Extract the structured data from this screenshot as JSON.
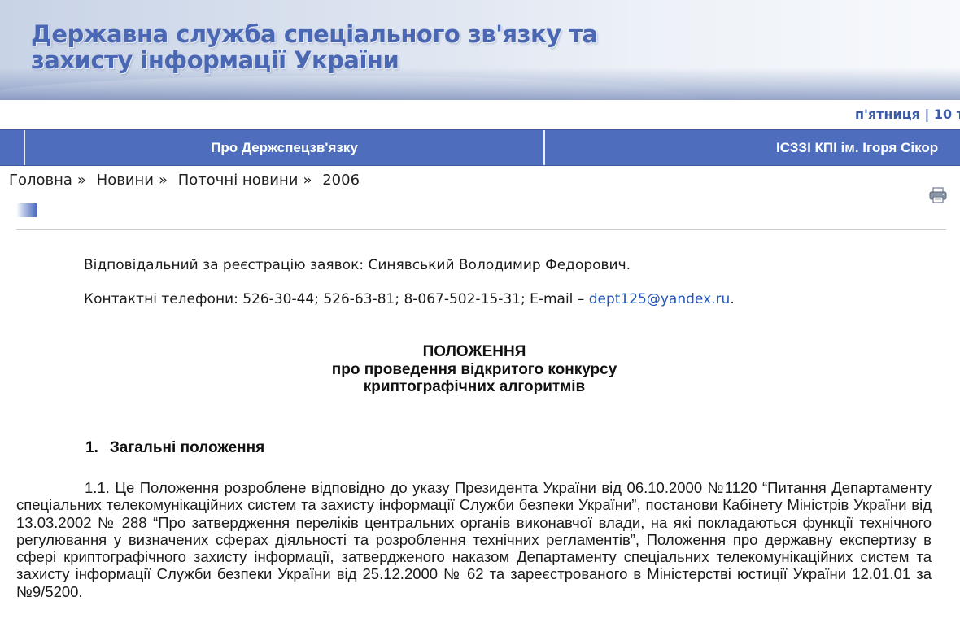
{
  "header": {
    "title_line1": "Державна служба спеціального зв'язку та",
    "title_line2": "захисту інформації України"
  },
  "date_text": "п'ятниця | 10 т",
  "nav": {
    "items": [
      {
        "label": "Про Держспецзв'язку"
      },
      {
        "label": "ІСЗЗІ КПІ ім. Ігоря Сікор"
      }
    ]
  },
  "breadcrumb": {
    "items": [
      "Головна",
      "Новини",
      "Поточні новини",
      "2006"
    ],
    "separator": "»"
  },
  "icons": {
    "print": "print-icon"
  },
  "contact": {
    "responsible": "Відповідальний за реєстрацію заявок: Синявський Володимир Федорович.",
    "phones_prefix": "Контактні телефони: 526-30-44; 526-63-81; 8-067-502-15-31; E-mail – ",
    "email": "dept125@yandex.ru",
    "phones_suffix": "."
  },
  "document": {
    "title_line1": "ПОЛОЖЕННЯ",
    "title_line2": "про проведення відкритого конкурсу",
    "title_line3": "криптографічних алгоритмів",
    "section_number": "1.",
    "section_title": "Загальні положення",
    "paragraph_1_1": "1.1.  Це Положення розроблене відповідно до указу Президента України від 06.10.2000 №1120 “Питання Департаменту спеціальних телекомунікаційних систем та захисту інформації Служби безпеки України”, постанови Кабінету Міністрів України від 13.03.2002 №  288 “Про затвердження переліків центральних органів виконавчої влади, на які покладаються функції технічного регулювання у визначених сферах діяльності та розроблення технічних регламентів”, Положення про державну експертизу в сфері криптографічного захисту інформації, затвердженого наказом Департаменту спеціальних телекомунікаційних систем та захисту інформації Служби безпеки України від 25.12.2000 № 62 та зареєстрованого в Міністерстві юстиції України 12.01.01 за №9/5200."
  },
  "colors": {
    "nav_bg": "#4e6ebd",
    "banner_text": "#4a67b3",
    "link": "#2456b8",
    "date_text": "#3c5aa8"
  }
}
